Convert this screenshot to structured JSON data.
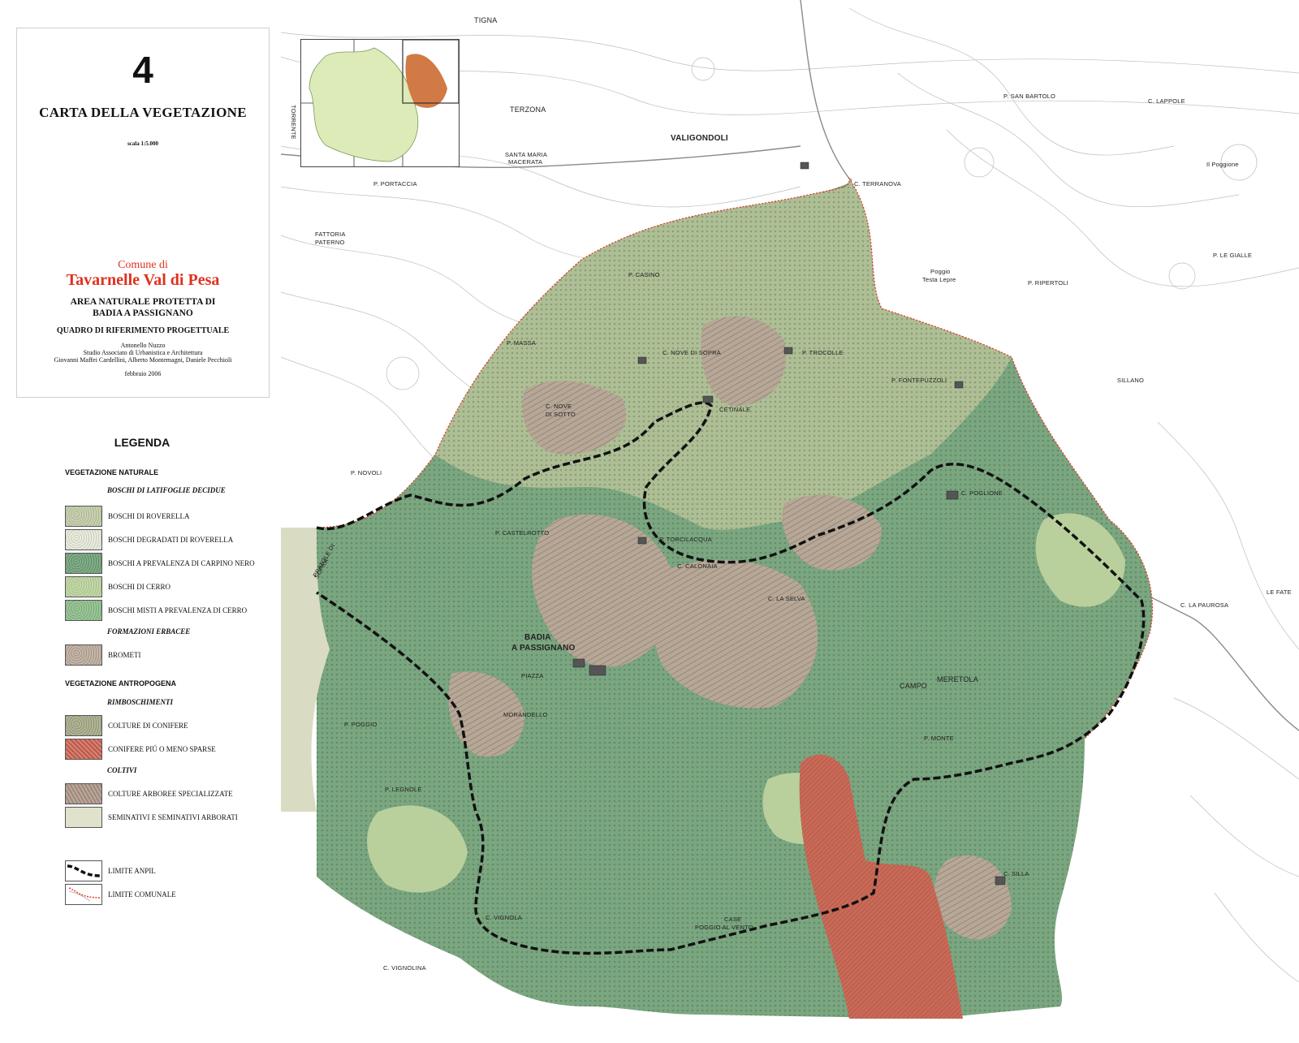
{
  "title_block": {
    "sheet_number": "4",
    "title": "CARTA DELLA VEGETAZIONE",
    "scale": "scala 1:5.000",
    "comune_di": "Comune di",
    "comune_name": "Tavarnelle Val di Pesa",
    "area_line1": "AREA NATURALE PROTETTA DI",
    "area_line2": "BADIA A PASSIGNANO",
    "quadro": "QUADRO DI RIFERIMENTO PROGETTUALE",
    "credit1": "Antonello Nuzzo",
    "credit2": "Studio Associato di Urbanistica e Architettura",
    "credit3": "Giovanni Maffei Cardellini, Alberto Montemagni, Daniele Pecchioli",
    "date": "febbraio 2006"
  },
  "legend": {
    "title": "LEGENDA",
    "natural_heading": "VEGETAZIONE NATURALE",
    "boschi_subheading": "BOSCHI DI LATIFOGLIE DECIDUE",
    "erbacee_subheading": "FORMAZIONI ERBACEE",
    "antropogena_heading": "VEGETAZIONE ANTROPOGENA",
    "rimboschimenti_subheading": "RIMBOSCHIMENTI",
    "coltivi_subheading": "COLTIVI",
    "items": [
      {
        "label": "BOSCHI DI ROVERELLA",
        "color": "#bcc6a5"
      },
      {
        "label": "BOSCHI DEGRADATI DI ROVERELLA",
        "color": "#dde0cf"
      },
      {
        "label": "BOSCHI A PREVALENZA DI CARPINO NERO",
        "color": "#79a47f"
      },
      {
        "label": "BOSCHI DI CERRO",
        "color": "#b8cf9b"
      },
      {
        "label": "BOSCHI MISTI A PREVALENZA DI CERRO",
        "color": "#8fbc8c"
      },
      {
        "label": "BROMETI",
        "color": "#b9aa9b"
      },
      {
        "label": "COLTURE DI CONIFERE",
        "color": "#a6a889"
      },
      {
        "label": "CONIFERE PIÚ O MENO SPARSE",
        "color": "#c8695a"
      },
      {
        "label": "COLTURE ARBOREE SPECIALIZZATE",
        "color": "#a49084"
      },
      {
        "label": "SEMINATIVI E SEMINATIVI ARBORATI",
        "color": "#dcdcc0"
      },
      {
        "label": "LIMITE ANPIL",
        "color": "#111111"
      },
      {
        "label": "LIMITE COMUNALE",
        "color": "#e53a2a"
      }
    ]
  },
  "map": {
    "place_names": [
      "TERZONA",
      "VALIGONDOLI",
      "SANTA MARIA",
      "MACERATA",
      "P. PORTACCIA",
      "FATTORIA",
      "PATERNO",
      "P. CASINO",
      "P. MASSA",
      "P. NOVOLI",
      "C. TERRANOVA",
      "Poggio",
      "Testa Lepre",
      "P. RIPERTOLI",
      "P. SAN BARTOLO",
      "C. LAPPOLE",
      "Il Poggione",
      "P. LE GIALLE",
      "SILLANO",
      "C. NOVE DI SOPRA",
      "P. TROCOLLE",
      "CETINALE",
      "C. NOVE",
      "DI SOTTO",
      "P. FONTEPUZZOLI",
      "C. POGLIONE",
      "P. CASTELROTTO",
      "P. TORCILACQUA",
      "C. CALONAIA",
      "C. LA SELVA",
      "C. LA PAUROSA",
      "LE FATE",
      "BADIA",
      "A PASSIGNANO",
      "PIAZZA",
      "CAMPO",
      "MERETOLA",
      "MORANDELLO",
      "P. POGGIO",
      "P. LEGNOLE",
      "P. MONTE",
      "C. SILLA",
      "C. VIGNOLA",
      "POGGIO AL VENTO",
      "CASE",
      "C. VIGNOLINA",
      "TIGNA",
      "TORRENTE",
      "PRATOLE DI",
      "SOPRA"
    ],
    "colors": {
      "carpino": "#7aa680",
      "roverella": "#aebf95",
      "brometi": "#b6a797",
      "conifere": "#c96a58",
      "cerro": "#b9d09c",
      "seminativi": "#d9dcc2",
      "anpil": "#111111",
      "comunale": "#e53a2a"
    }
  }
}
